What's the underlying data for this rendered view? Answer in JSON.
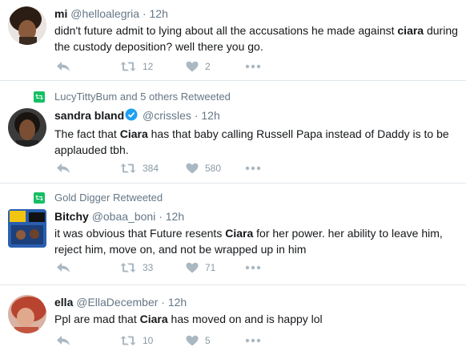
{
  "tweets": [
    {
      "retweeted_by": "",
      "name": "mi",
      "handle": "@helloalegria",
      "time": "12h",
      "text_parts": [
        "didn't future admit to lying about all the accusations he made against ",
        "ciara",
        " during the custody deposition? well there you go."
      ],
      "verified": false,
      "retweets": "12",
      "likes": "2"
    },
    {
      "retweeted_by": "LucyTittyBum and 5 others Retweeted",
      "name": "sandra bland",
      "handle": "@crissles",
      "time": "12h",
      "text_parts": [
        "The fact that ",
        "Ciara",
        " has that baby calling Russell Papa instead of Daddy is to be applauded tbh."
      ],
      "verified": true,
      "retweets": "384",
      "likes": "580"
    },
    {
      "retweeted_by": "Gold Digger Retweeted",
      "name": "Bitchy",
      "handle": "@obaa_boni",
      "time": "12h",
      "text_parts": [
        "it was obvious that Future resents ",
        "Ciara",
        " for her power. her ability to leave him, reject him, move on, and not be wrapped up in him"
      ],
      "verified": false,
      "retweets": "33",
      "likes": "71"
    },
    {
      "retweeted_by": "",
      "name": "ella",
      "handle": "@EllaDecember",
      "time": "12h",
      "text_parts": [
        "Ppl are mad that ",
        "Ciara",
        " has moved on and is happy lol"
      ],
      "verified": false,
      "retweets": "10",
      "likes": "5"
    }
  ],
  "dot": "·",
  "icons": {
    "reply": "reply-icon",
    "retweet": "retweet-icon",
    "like": "heart-icon",
    "more": "more-icon",
    "verified": "verified-badge-icon"
  },
  "colors": {
    "text": "#14171a",
    "muted": "#657786",
    "action": "#8899a6",
    "retweet_green": "#17bf63",
    "verified_blue": "#1da1f2",
    "divider": "#e1e8ed"
  }
}
